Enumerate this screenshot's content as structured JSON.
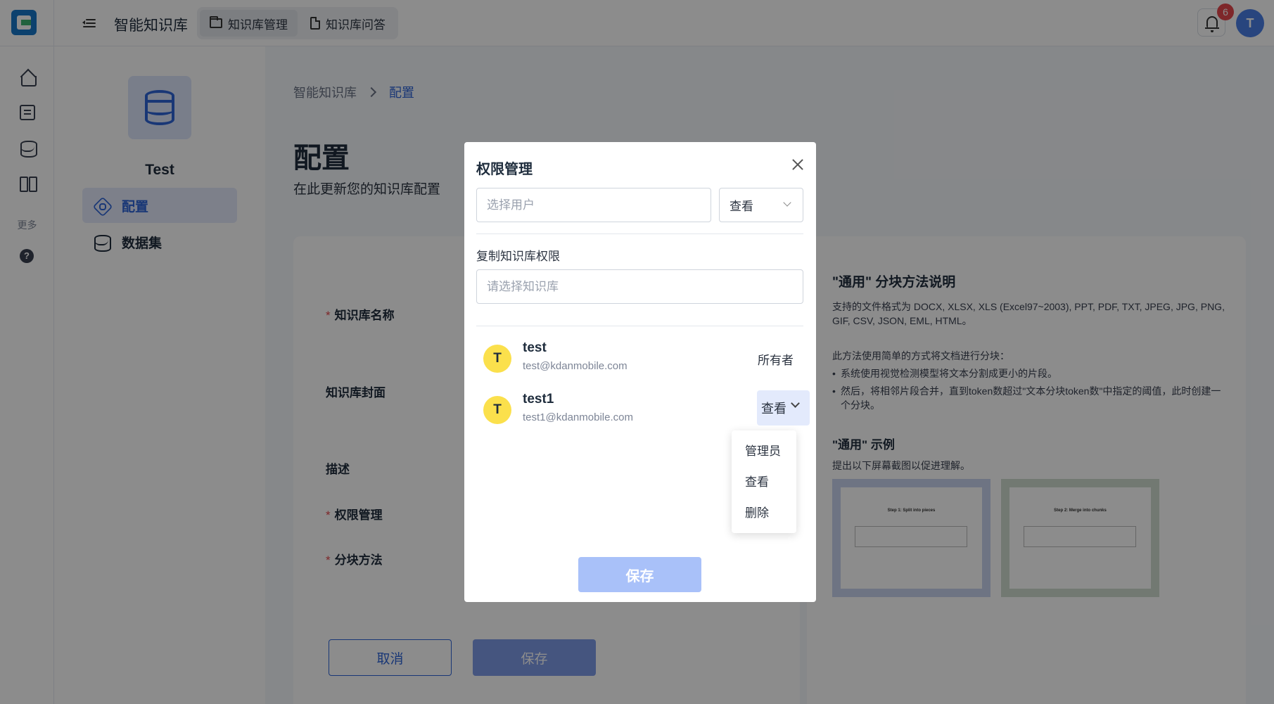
{
  "topbar": {
    "app_title": "智能知识库",
    "tabs": [
      {
        "label": "知识库管理",
        "icon": "folder-icon"
      },
      {
        "label": "知识库问答",
        "icon": "document-icon"
      }
    ],
    "notification_count": "6",
    "avatar_letter": "T"
  },
  "rail": {
    "more_label": "更多",
    "icons": [
      "home-icon",
      "list-icon",
      "database-icon",
      "split-icon",
      "help-icon"
    ]
  },
  "panel": {
    "kb_name": "Test",
    "nav": [
      {
        "label": "配置",
        "icon": "settings-hex-icon"
      },
      {
        "label": "数据集",
        "icon": "database-icon"
      }
    ]
  },
  "main": {
    "breadcrumb": [
      "智能知识库",
      "配置"
    ],
    "title": "配置",
    "subtitle": "在此更新您的知识库配置",
    "form_labels": {
      "name": "知识库名称",
      "cover": "知识库封面",
      "description": "描述",
      "permission": "权限管理",
      "chunk_method": "分块方法"
    },
    "cancel_label": "取消",
    "save_label": "保存"
  },
  "info": {
    "title": "\"通用\" 分块方法说明",
    "formats": "支持的文件格式为 DOCX, XLSX, XLS (Excel97~2003), PPT, PDF, TXT, JPEG, JPG, PNG, GIF, CSV, JSON, EML, HTML。",
    "intro": "此方法使用简单的方式将文档进行分块：",
    "bullets": [
      "系统使用视觉检测模型将文本分割成更小的片段。",
      "然后，将相邻片段合并，直到token数超过\"文本分块token数\"中指定的阈值，此时创建一个分块。"
    ],
    "example_title": "\"通用\" 示例",
    "example_sub": "提出以下屏幕截图以促进理解。",
    "thumbs": [
      "Step 1: Split into pieces",
      "Step 2: Merge into chunks"
    ]
  },
  "modal": {
    "title": "权限管理",
    "user_placeholder": "选择用户",
    "role_value": "查看",
    "copy_label": "复制知识库权限",
    "kb_placeholder": "请选择知识库",
    "members": [
      {
        "avatar": "T",
        "name": "test",
        "email": "test@kdanmobile.com",
        "role": "所有者"
      },
      {
        "avatar": "T",
        "name": "test1",
        "email": "test1@kdanmobile.com",
        "role": "查看"
      }
    ],
    "dropdown_options": [
      "管理员",
      "查看",
      "删除"
    ],
    "save_label": "保存"
  }
}
